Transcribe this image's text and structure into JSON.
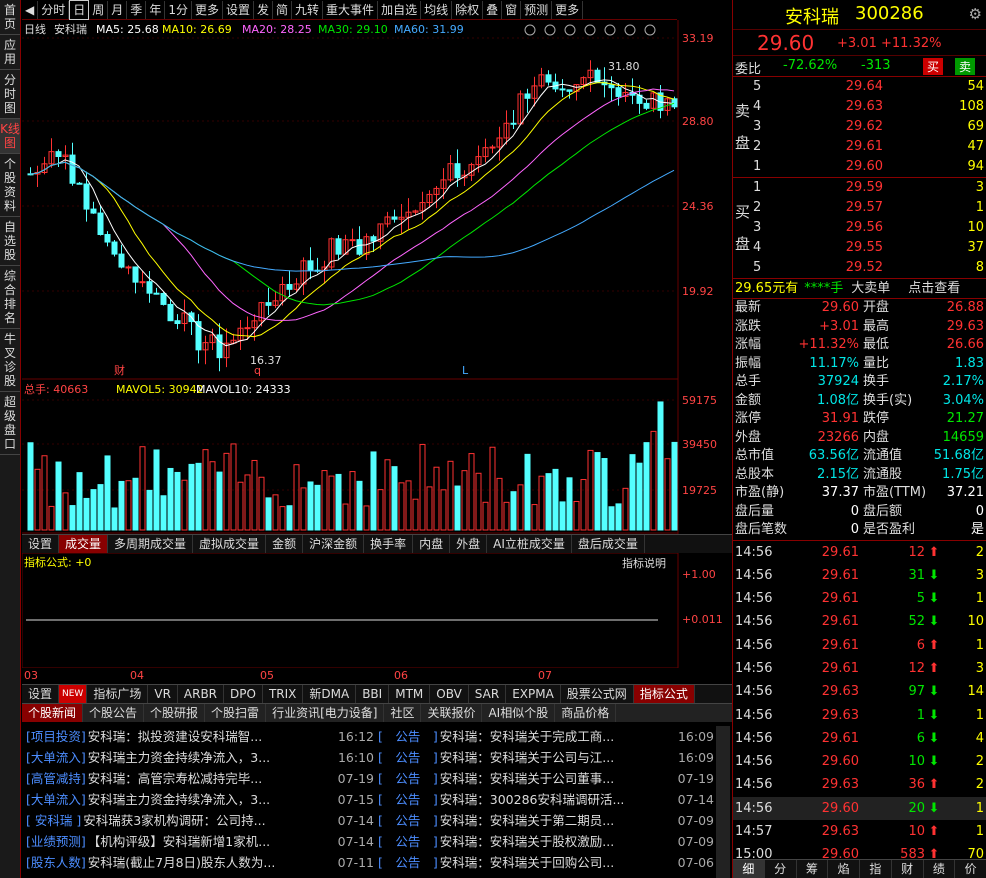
{
  "lnav": [
    "首页",
    "应用",
    "分时图",
    "K线图",
    "个股资料",
    "自选股",
    "综合排名",
    "牛叉诊股",
    "超级盘口"
  ],
  "toolbar": [
    "分时",
    "日",
    "周",
    "月",
    "季",
    "年",
    "1分",
    "更多",
    "设置",
    "发",
    "简",
    "九转",
    "重大事件",
    "加自选",
    "均线",
    "除权",
    "叠",
    "窗",
    "预测",
    "更多"
  ],
  "chart_header": {
    "period": "日线",
    "name": "安科瑞",
    "ma5": "MA5: 25.68",
    "ma10": "MA10: 26.69",
    "ma20": "MA20: 28.25",
    "ma30": "MA30: 29.10",
    "ma60": "MA60: 31.99"
  },
  "price_axis": [
    "33.19",
    "28.80",
    "24.36",
    "19.92"
  ],
  "hi_label": "31.80",
  "lo_label": "16.37",
  "marks": [
    "财",
    "q",
    "L"
  ],
  "vol_header": {
    "total": "总手: 40663",
    "mavol5": "MAVOL5: 30942",
    "mavol10": "MAVOL10: 24333"
  },
  "vol_axis": [
    "59175",
    "39450",
    "19725"
  ],
  "vol_tabs": [
    "设置",
    "成交量",
    "多周期成交量",
    "虚拟成交量",
    "金额",
    "沪深金额",
    "换手率",
    "内盘",
    "外盘",
    "AI立桩成交量",
    "盘后成交量"
  ],
  "ind_header": {
    "formula": "指标公式: +0",
    "explain": "指标说明"
  },
  "ind_axis": [
    "+1.00",
    "+0.011"
  ],
  "months": [
    "03",
    "04",
    "05",
    "06",
    "07"
  ],
  "ind_tabs": [
    "设置",
    "NEW",
    "指标广场",
    "VR",
    "ARBR",
    "DPO",
    "TRIX",
    "新DMA",
    "BBI",
    "MTM",
    "OBV",
    "SAR",
    "EXPMA",
    "股票公式网",
    "指标公式"
  ],
  "news_tabs": [
    "个股新闻",
    "个股公告",
    "个股研报",
    "个股扫雷",
    "行业资讯[电力设备]",
    "社区",
    "关联报价",
    "AI相似个股",
    "商品价格"
  ],
  "news_left": [
    {
      "tag": "[项目投资]",
      "title": "安科瑞：拟投资建设安科瑞智...",
      "date": "16:12"
    },
    {
      "tag": "[大单流入]",
      "title": "安科瑞主力资金持续净流入，3...",
      "date": "16:10"
    },
    {
      "tag": "[高管减持]",
      "title": "安科瑞：高管宗寿松减持完毕...",
      "date": "07-19"
    },
    {
      "tag": "[大单流入]",
      "title": "安科瑞主力资金持续净流入，3...",
      "date": "07-15"
    },
    {
      "tag": "[ 安科瑞 ]",
      "title": "安科瑞获3家机构调研：公司持...",
      "date": "07-14"
    },
    {
      "tag": "[业绩预测]",
      "title": "【机构评级】安科瑞新增1家机...",
      "date": "07-14"
    },
    {
      "tag": "[股东人数]",
      "title": "安科瑞(截止7月8日)股东人数为...",
      "date": "07-11"
    }
  ],
  "news_right": [
    {
      "tag": "[　公告　]",
      "title": "安科瑞：安科瑞关于完成工商...",
      "date": "16:09"
    },
    {
      "tag": "[　公告　]",
      "title": "安科瑞：安科瑞关于公司与江...",
      "date": "16:09"
    },
    {
      "tag": "[　公告　]",
      "title": "安科瑞：安科瑞关于公司董事...",
      "date": "07-19"
    },
    {
      "tag": "[　公告　]",
      "title": "安科瑞：300286安科瑞调研活...",
      "date": "07-14"
    },
    {
      "tag": "[　公告　]",
      "title": "安科瑞：安科瑞关于第二期员...",
      "date": "07-09"
    },
    {
      "tag": "[　公告　]",
      "title": "安科瑞：安科瑞关于股权激励...",
      "date": "07-09"
    },
    {
      "tag": "[　公告　]",
      "title": "安科瑞：安科瑞关于回购公司...",
      "date": "07-06"
    }
  ],
  "quote": {
    "name": "安科瑞",
    "code": "300286",
    "price": "29.60",
    "change": "+3.01",
    "pct": "+11.32%"
  },
  "weibi": {
    "label": "委比",
    "val": "-72.62%",
    "diff": "-313",
    "buy": "买",
    "sell": "卖"
  },
  "sell_side": "卖盘",
  "buy_side": "买盘",
  "asks": [
    [
      "5",
      "29.64",
      "54"
    ],
    [
      "4",
      "29.63",
      "108"
    ],
    [
      "3",
      "29.62",
      "69"
    ],
    [
      "2",
      "29.61",
      "47"
    ],
    [
      "1",
      "29.60",
      "94"
    ]
  ],
  "bids": [
    [
      "1",
      "29.59",
      "3"
    ],
    [
      "2",
      "29.57",
      "1"
    ],
    [
      "3",
      "29.56",
      "10"
    ],
    [
      "4",
      "29.55",
      "37"
    ],
    [
      "5",
      "29.52",
      "8"
    ]
  ],
  "bigorder": {
    "price": "29.65元有",
    "hand": "****手",
    "label": "大卖单",
    "link": "点击查看"
  },
  "stats": [
    [
      "最新",
      "29.60",
      "开盘",
      "26.88"
    ],
    [
      "涨跌",
      "+3.01",
      "最高",
      "29.63"
    ],
    [
      "涨幅",
      "+11.32%",
      "最低",
      "26.66"
    ],
    [
      "振幅",
      "11.17%",
      "量比",
      "1.83"
    ],
    [
      "总手",
      "37924",
      "换手",
      "2.17%"
    ],
    [
      "金额",
      "1.08亿",
      "换手(实)",
      "3.04%"
    ],
    [
      "涨停",
      "31.91",
      "跌停",
      "21.27"
    ],
    [
      "外盘",
      "23266",
      "内盘",
      "14659"
    ],
    [
      "总市值",
      "63.56亿",
      "流通值",
      "51.68亿"
    ],
    [
      "总股本",
      "2.15亿",
      "流通股",
      "1.75亿"
    ],
    [
      "市盈(静)",
      "37.37",
      "市盈(TTM)",
      "37.21"
    ],
    [
      "盘后量",
      "0",
      "盘后额",
      "0"
    ],
    [
      "盘后笔数",
      "0",
      "是否盈利",
      "是"
    ]
  ],
  "ticks": [
    [
      "14:56",
      "29.61",
      "12",
      "up",
      "2"
    ],
    [
      "14:56",
      "29.61",
      "31",
      "down",
      "3"
    ],
    [
      "14:56",
      "29.61",
      "5",
      "down",
      "1"
    ],
    [
      "14:56",
      "29.61",
      "52",
      "down",
      "10"
    ],
    [
      "14:56",
      "29.61",
      "6",
      "up",
      "1"
    ],
    [
      "14:56",
      "29.61",
      "12",
      "up",
      "3"
    ],
    [
      "14:56",
      "29.63",
      "97",
      "down",
      "14"
    ],
    [
      "14:56",
      "29.63",
      "1",
      "down",
      "1"
    ],
    [
      "14:56",
      "29.61",
      "6",
      "down",
      "4"
    ],
    [
      "14:56",
      "29.60",
      "10",
      "down",
      "2"
    ],
    [
      "14:56",
      "29.63",
      "36",
      "up",
      "2"
    ],
    [
      "14:56",
      "29.60",
      "20",
      "down",
      "1"
    ],
    [
      "14:57",
      "29.63",
      "10",
      "up",
      "1"
    ],
    [
      "15:00",
      "29.60",
      "583",
      "up",
      "70"
    ]
  ],
  "bottom_tabs": [
    "细",
    "分",
    "筹",
    "焰",
    "指",
    "财",
    "绩",
    "价"
  ]
}
